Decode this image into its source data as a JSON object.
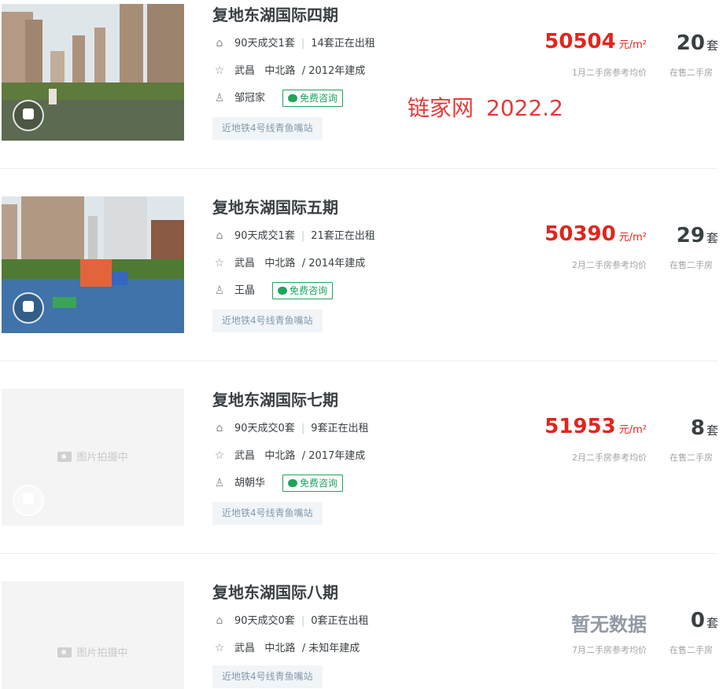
{
  "watermark": {
    "site": "链家网",
    "date": "2022.2"
  },
  "listings": [
    {
      "title": "复地东湖国际四期",
      "deals": "90天成交1套",
      "rentals": "14套正在出租",
      "district": "武昌",
      "area": "中北路",
      "built": "/ 2012年建成",
      "agent": "邹冠家",
      "consult": "免费咨询",
      "subway_tag": "近地铁4号线青鱼嘴站",
      "price": "50504",
      "price_unit": "元/m²",
      "price_note": "1月二手房参考均价",
      "on_sale": "20",
      "on_sale_unit": "套",
      "on_sale_note": "在售二手房",
      "photo": "residential-towers-lake"
    },
    {
      "title": "复地东湖国际五期",
      "deals": "90天成交1套",
      "rentals": "21套正在出租",
      "district": "武昌",
      "area": "中北路",
      "built": "/ 2014年建成",
      "agent": "王晶",
      "consult": "免费咨询",
      "subway_tag": "近地铁4号线青鱼嘴站",
      "price": "50390",
      "price_unit": "元/m²",
      "price_note": "2月二手房参考均价",
      "on_sale": "29",
      "on_sale_unit": "套",
      "on_sale_note": "在售二手房",
      "photo": "towers-playground"
    },
    {
      "title": "复地东湖国际七期",
      "deals": "90天成交0套",
      "rentals": "9套正在出租",
      "district": "武昌",
      "area": "中北路",
      "built": "/ 2017年建成",
      "agent": "胡朝华",
      "consult": "免费咨询",
      "subway_tag": "近地铁4号线青鱼嘴站",
      "price": "51953",
      "price_unit": "元/m²",
      "price_note": "2月二手房参考均价",
      "on_sale": "8",
      "on_sale_unit": "套",
      "on_sale_note": "在售二手房",
      "placeholder": "图片拍摄中"
    },
    {
      "title": "复地东湖国际八期",
      "deals": "90天成交0套",
      "rentals": "0套正在出租",
      "district": "武昌",
      "area": "中北路",
      "built": "/ 未知年建成",
      "subway_tag": "近地铁4号线青鱼嘴站",
      "price_none": "暂无数据",
      "price_note": "7月二手房参考均价",
      "on_sale": "0",
      "on_sale_unit": "套",
      "on_sale_note": "在售二手房",
      "placeholder": "图片拍摄中"
    }
  ],
  "icons": {
    "home": "home-icon",
    "star": "star-icon",
    "person": "person-icon",
    "wechat": "chat-bubble-icon",
    "camera": "camera-icon",
    "vr": "vr-icon"
  },
  "colors": {
    "price": "#e1251b",
    "consult": "#1ea35b",
    "tag_bg": "#f2f5f7",
    "watermark": "#e53a3a"
  }
}
